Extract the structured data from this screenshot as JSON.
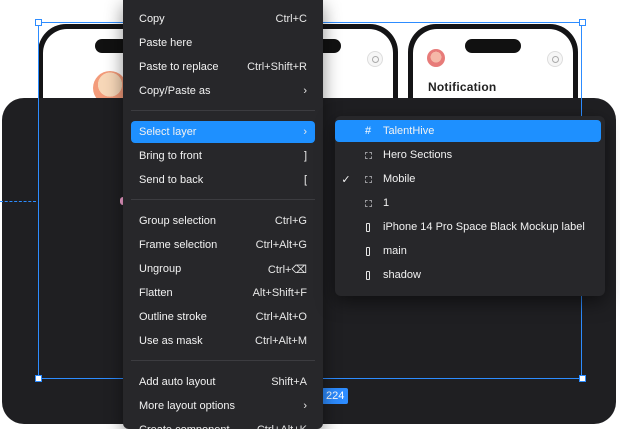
{
  "canvas": {
    "notification_title": "Notification",
    "size_badge": "224"
  },
  "context_menu": {
    "items": [
      {
        "label": "Copy",
        "shortcut": "Ctrl+C",
        "submenu": false
      },
      {
        "label": "Paste here",
        "shortcut": "",
        "submenu": false
      },
      {
        "label": "Paste to replace",
        "shortcut": "Ctrl+Shift+R",
        "submenu": false
      },
      {
        "label": "Copy/Paste as",
        "shortcut": "›",
        "submenu": true
      },
      {
        "label": "Select layer",
        "shortcut": "›",
        "submenu": true,
        "active": true
      },
      {
        "label": "Bring to front",
        "shortcut": "]",
        "submenu": false
      },
      {
        "label": "Send to back",
        "shortcut": "[",
        "submenu": false
      },
      {
        "label": "Group selection",
        "shortcut": "Ctrl+G",
        "submenu": false
      },
      {
        "label": "Frame selection",
        "shortcut": "Ctrl+Alt+G",
        "submenu": false
      },
      {
        "label": "Ungroup",
        "shortcut": "Ctrl+⌫",
        "submenu": false
      },
      {
        "label": "Flatten",
        "shortcut": "Alt+Shift+F",
        "submenu": false
      },
      {
        "label": "Outline stroke",
        "shortcut": "Ctrl+Alt+O",
        "submenu": false
      },
      {
        "label": "Use as mask",
        "shortcut": "Ctrl+Alt+M",
        "submenu": false
      },
      {
        "label": "Add auto layout",
        "shortcut": "Shift+A",
        "submenu": false
      },
      {
        "label": "More layout options",
        "shortcut": "›",
        "submenu": true
      },
      {
        "label": "Create component",
        "shortcut": "Ctrl+Alt+K",
        "submenu": false
      }
    ]
  },
  "select_layer_submenu": {
    "items": [
      {
        "label": "TalentHive",
        "icon": "frame-icon",
        "checked": false,
        "active": true
      },
      {
        "label": "Hero Sections",
        "icon": "section-icon",
        "checked": false,
        "active": false
      },
      {
        "label": "Mobile",
        "icon": "section-icon",
        "checked": true,
        "active": false
      },
      {
        "label": "1",
        "icon": "section-icon",
        "checked": false,
        "active": false
      },
      {
        "label": "iPhone 14 Pro Space Black Mockup label",
        "icon": "rectangle-icon",
        "checked": false,
        "active": false
      },
      {
        "label": "main",
        "icon": "rectangle-icon",
        "checked": false,
        "active": false
      },
      {
        "label": "shadow",
        "icon": "rectangle-icon",
        "checked": false,
        "active": false
      }
    ],
    "check_glyph": "✓",
    "frame_glyph": "#"
  },
  "colors": {
    "accent": "#1e90ff",
    "menu_bg": "#27272a",
    "canvas_dark": "#1f1f22"
  }
}
